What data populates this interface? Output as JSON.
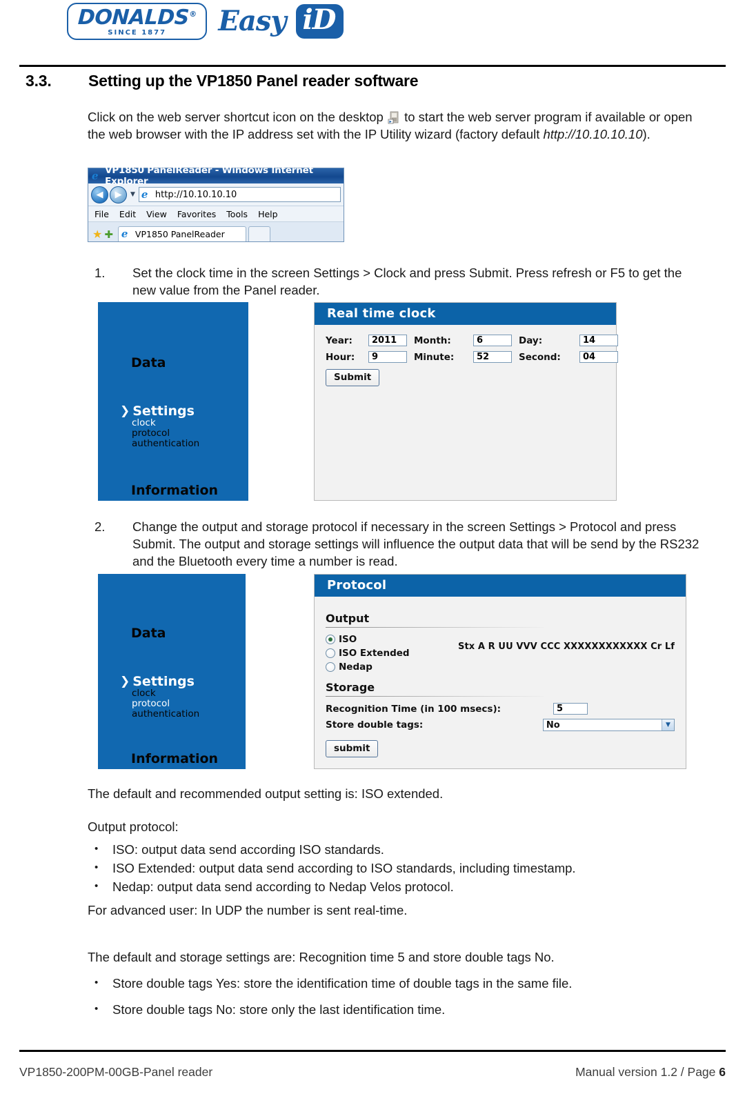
{
  "header": {
    "logo_brand": "DONALDS",
    "logo_registered": "®",
    "logo_since": "SINCE 1877",
    "logo_easy": "Easy",
    "logo_id": "iD"
  },
  "section": {
    "number": "3.3.",
    "title": "Setting up the VP1850 Panel reader software",
    "intro_part1": "Click on the web server shortcut icon on the desktop",
    "intro_part2": "to start the web server program if available or open the web browser with the IP address set with the IP Utility wizard (factory default ",
    "intro_url": "http://10.10.10.10",
    "intro_part3": ")."
  },
  "browser": {
    "title": "VP1850 PanelReader  - Windows Internet Explorer",
    "url": "http://10.10.10.10",
    "back_glyph": "◀",
    "forward_glyph": "▶",
    "dropdown_glyph": "▼",
    "menu": [
      "File",
      "Edit",
      "View",
      "Favorites",
      "Tools",
      "Help"
    ],
    "star_glyph": "★",
    "plus_glyph": "✚",
    "tab_label": "VP1850 PanelReader",
    "ie_letter": "e"
  },
  "steps": [
    {
      "marker": "1.",
      "text": "Set the clock time in the screen Settings > Clock and press Submit. Press refresh or F5 to get the new value from the Panel reader."
    },
    {
      "marker": "2.",
      "text": "Change the output and storage protocol if necessary in the screen Settings > Protocol and press Submit. The output and storage settings will influence the output data that will be send by the RS232 and the Bluetooth every time a number is read."
    }
  ],
  "app_nav": {
    "data": "Data",
    "settings": "Settings",
    "chevron": "❯",
    "sub_clock": "clock",
    "sub_protocol": "protocol",
    "sub_authentication": "authentication",
    "information": "Information"
  },
  "clock_panel": {
    "title": "Real time clock",
    "fields": [
      {
        "label": "Year:",
        "value": "2011"
      },
      {
        "label": "Month:",
        "value": "6"
      },
      {
        "label": "Day:",
        "value": "14"
      },
      {
        "label": "Hour:",
        "value": "9"
      },
      {
        "label": "Minute:",
        "value": "52"
      },
      {
        "label": "Second:",
        "value": "04"
      }
    ],
    "submit": "Submit"
  },
  "protocol_panel": {
    "title": "Protocol",
    "output_group": "Output",
    "options": [
      {
        "label": "ISO",
        "selected": true
      },
      {
        "label": "ISO Extended",
        "selected": false
      },
      {
        "label": "Nedap",
        "selected": false
      }
    ],
    "format_string": "Stx A R UU VVV CCC XXXXXXXXXXXX Cr Lf",
    "storage_group": "Storage",
    "recognition_label": "Recognition Time (in 100 msecs):",
    "recognition_value": "5",
    "store_label": "Store double tags:",
    "store_value": "No",
    "select_arrow": "▼",
    "submit": "submit"
  },
  "notes": {
    "default_output": "The default and recommended output setting is: ISO extended.",
    "output_protocol_heading": "Output protocol:",
    "output_bullets": [
      "ISO: output data send according ISO standards.",
      "ISO Extended: output data send according to ISO standards, including timestamp.",
      "Nedap: output data send according to Nedap Velos protocol."
    ],
    "advanced_user": "For advanced user: In UDP the number is sent real-time.",
    "default_storage": "The default and storage settings are: Recognition time 5 and store double tags No.",
    "storage_bullets": [
      "Store double tags Yes: store the identification time of double tags in the same file.",
      "Store double tags No: store only the last identification time."
    ]
  },
  "footer": {
    "left": "VP1850-200PM-00GB-Panel reader",
    "right_text": "Manual version 1.2 / Page ",
    "page_number": "6"
  },
  "colors": {
    "brand_blue": "#1a5fa8",
    "sidebar_blue": "#1168b0",
    "panel_header_blue": "#0c63a8",
    "panel_bg": "#f2f2f2",
    "radio_dot_green": "#2d6f3d"
  }
}
